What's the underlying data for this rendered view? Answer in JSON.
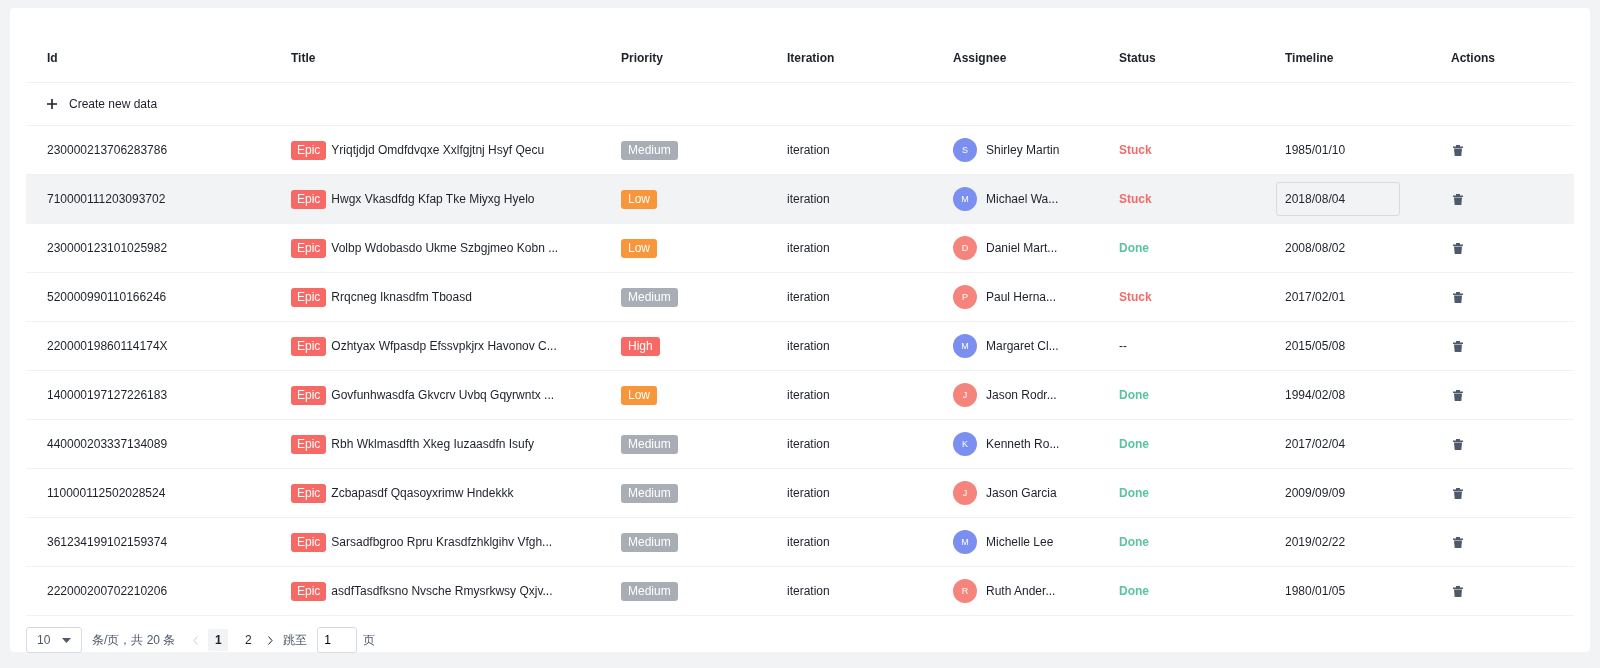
{
  "table": {
    "columns": [
      "Id",
      "Title",
      "Priority",
      "Iteration",
      "Assignee",
      "Status",
      "Timeline",
      "Actions"
    ],
    "create_label": "Create new data",
    "rows": [
      {
        "id": "230000213706283786",
        "tag": "Epic",
        "title": "Yriqtjdjd Omdfdvqxe Xxlfgjtnj Hsyf Qecu",
        "priority": {
          "text": "Medium",
          "kind": "medium"
        },
        "iteration": "iteration",
        "assignee": {
          "initial": "S",
          "name": "Shirley Martin",
          "color": "#7b8ff0"
        },
        "status": {
          "text": "Stuck",
          "kind": "stuck"
        },
        "timeline": "1985/01/10",
        "hovered": false,
        "editing": false
      },
      {
        "id": "710000111203093702",
        "tag": "Epic",
        "title": "Hwgx Vkasdfdg Kfap Tke Miyxg Hyelo",
        "priority": {
          "text": "Low",
          "kind": "low"
        },
        "iteration": "iteration",
        "assignee": {
          "initial": "M",
          "name": "Michael Wa...",
          "color": "#7b8ff0"
        },
        "status": {
          "text": "Stuck",
          "kind": "stuck"
        },
        "timeline": "2018/08/04",
        "hovered": true,
        "editing": true
      },
      {
        "id": "230000123101025982",
        "tag": "Epic",
        "title": "Volbp Wdobasdo Ukme Szbgjmeo Kobn ...",
        "priority": {
          "text": "Low",
          "kind": "low"
        },
        "iteration": "iteration",
        "assignee": {
          "initial": "D",
          "name": "Daniel Mart...",
          "color": "#f5857c"
        },
        "status": {
          "text": "Done",
          "kind": "done"
        },
        "timeline": "2008/08/02",
        "hovered": false,
        "editing": false
      },
      {
        "id": "520000990110166246",
        "tag": "Epic",
        "title": "Rrqcneg Iknasdfm Tboasd",
        "priority": {
          "text": "Medium",
          "kind": "medium"
        },
        "iteration": "iteration",
        "assignee": {
          "initial": "P",
          "name": "Paul Herna...",
          "color": "#f5857c"
        },
        "status": {
          "text": "Stuck",
          "kind": "stuck"
        },
        "timeline": "2017/02/01",
        "hovered": false,
        "editing": false
      },
      {
        "id": "22000019860114174X",
        "tag": "Epic",
        "title": "Ozhtyax Wfpasdp Efssvpkjrx Havonov C...",
        "priority": {
          "text": "High",
          "kind": "high"
        },
        "iteration": "iteration",
        "assignee": {
          "initial": "M",
          "name": "Margaret Cl...",
          "color": "#7b8ff0"
        },
        "status": {
          "text": "--",
          "kind": "none"
        },
        "timeline": "2015/05/08",
        "hovered": false,
        "editing": false
      },
      {
        "id": "140000197127226183",
        "tag": "Epic",
        "title": "Govfunhwasdfa Gkvcrv Uvbq Gqyrwntx ...",
        "priority": {
          "text": "Low",
          "kind": "low"
        },
        "iteration": "iteration",
        "assignee": {
          "initial": "J",
          "name": "Jason Rodr...",
          "color": "#f5857c"
        },
        "status": {
          "text": "Done",
          "kind": "done"
        },
        "timeline": "1994/02/08",
        "hovered": false,
        "editing": false
      },
      {
        "id": "440000203337134089",
        "tag": "Epic",
        "title": "Rbh Wklmasdfth Xkeg Iuzaasdfn Isufy",
        "priority": {
          "text": "Medium",
          "kind": "medium"
        },
        "iteration": "iteration",
        "assignee": {
          "initial": "K",
          "name": "Kenneth Ro...",
          "color": "#7b8ff0"
        },
        "status": {
          "text": "Done",
          "kind": "done"
        },
        "timeline": "2017/02/04",
        "hovered": false,
        "editing": false
      },
      {
        "id": "110000112502028524",
        "tag": "Epic",
        "title": "Zcbapasdf Qqasoyxrimw Hndekkk",
        "priority": {
          "text": "Medium",
          "kind": "medium"
        },
        "iteration": "iteration",
        "assignee": {
          "initial": "J",
          "name": "Jason Garcia",
          "color": "#f5857c"
        },
        "status": {
          "text": "Done",
          "kind": "done"
        },
        "timeline": "2009/09/09",
        "hovered": false,
        "editing": false
      },
      {
        "id": "361234199102159374",
        "tag": "Epic",
        "title": "Sarsadfbgroo Rpru Krasdfzhklgihv Vfgh...",
        "priority": {
          "text": "Medium",
          "kind": "medium"
        },
        "iteration": "iteration",
        "assignee": {
          "initial": "M",
          "name": "Michelle Lee",
          "color": "#7b8ff0"
        },
        "status": {
          "text": "Done",
          "kind": "done"
        },
        "timeline": "2019/02/22",
        "hovered": false,
        "editing": false
      },
      {
        "id": "222000200702210206",
        "tag": "Epic",
        "title": "asdfTasdfksno Nvsche Rmysrkwsy Qxjv...",
        "priority": {
          "text": "Medium",
          "kind": "medium"
        },
        "iteration": "iteration",
        "assignee": {
          "initial": "R",
          "name": "Ruth Ander...",
          "color": "#f5857c"
        },
        "status": {
          "text": "Done",
          "kind": "done"
        },
        "timeline": "1980/01/05",
        "hovered": false,
        "editing": false
      }
    ]
  },
  "pagination": {
    "page_size": "10",
    "summary": "条/页，共 20 条",
    "pages": [
      {
        "label": "1",
        "selected": true
      },
      {
        "label": "2",
        "selected": false
      }
    ],
    "jump_label": "跳至",
    "jump_value": "1",
    "jump_suffix": "页"
  }
}
